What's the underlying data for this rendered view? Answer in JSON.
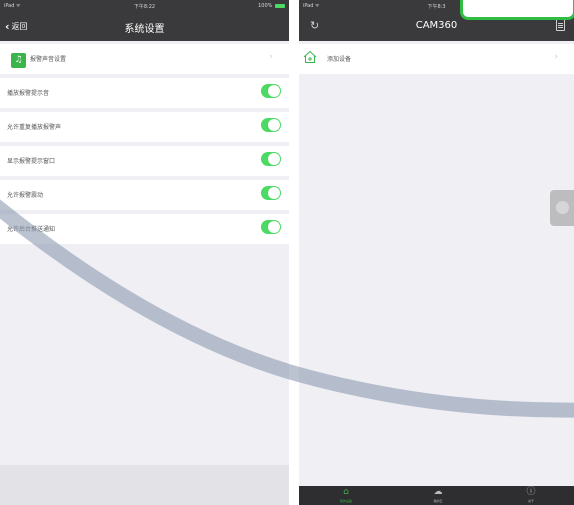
{
  "left": {
    "status": {
      "device": "iPad ᯤ",
      "time": "下午8:22",
      "battery": "100%"
    },
    "nav": {
      "back": "返回",
      "title": "系统设置"
    },
    "sound_row": {
      "label": "报警声音设置"
    },
    "toggles": [
      {
        "label": "播放报警提示音",
        "on": true
      },
      {
        "label": "允许重复播放报警声",
        "on": true
      },
      {
        "label": "显示报警提示窗口",
        "on": true
      },
      {
        "label": "允许报警震动",
        "on": true
      },
      {
        "label": "允许后台推送通知",
        "on": true
      }
    ]
  },
  "right": {
    "status": {
      "device": "iPad ᯤ",
      "time": "下午8:3"
    },
    "nav": {
      "title": "CAM360"
    },
    "add_device": {
      "label": "添加设备"
    },
    "tabs": [
      {
        "label": "我的设备"
      },
      {
        "label": "我的云"
      },
      {
        "label": "关于"
      }
    ]
  },
  "colors": {
    "nav": "#3a3a3c",
    "accent": "#3bb44a",
    "toggle": "#4cd964",
    "background": "#efeff4",
    "overlay_stroke": "#8e9bb3"
  }
}
